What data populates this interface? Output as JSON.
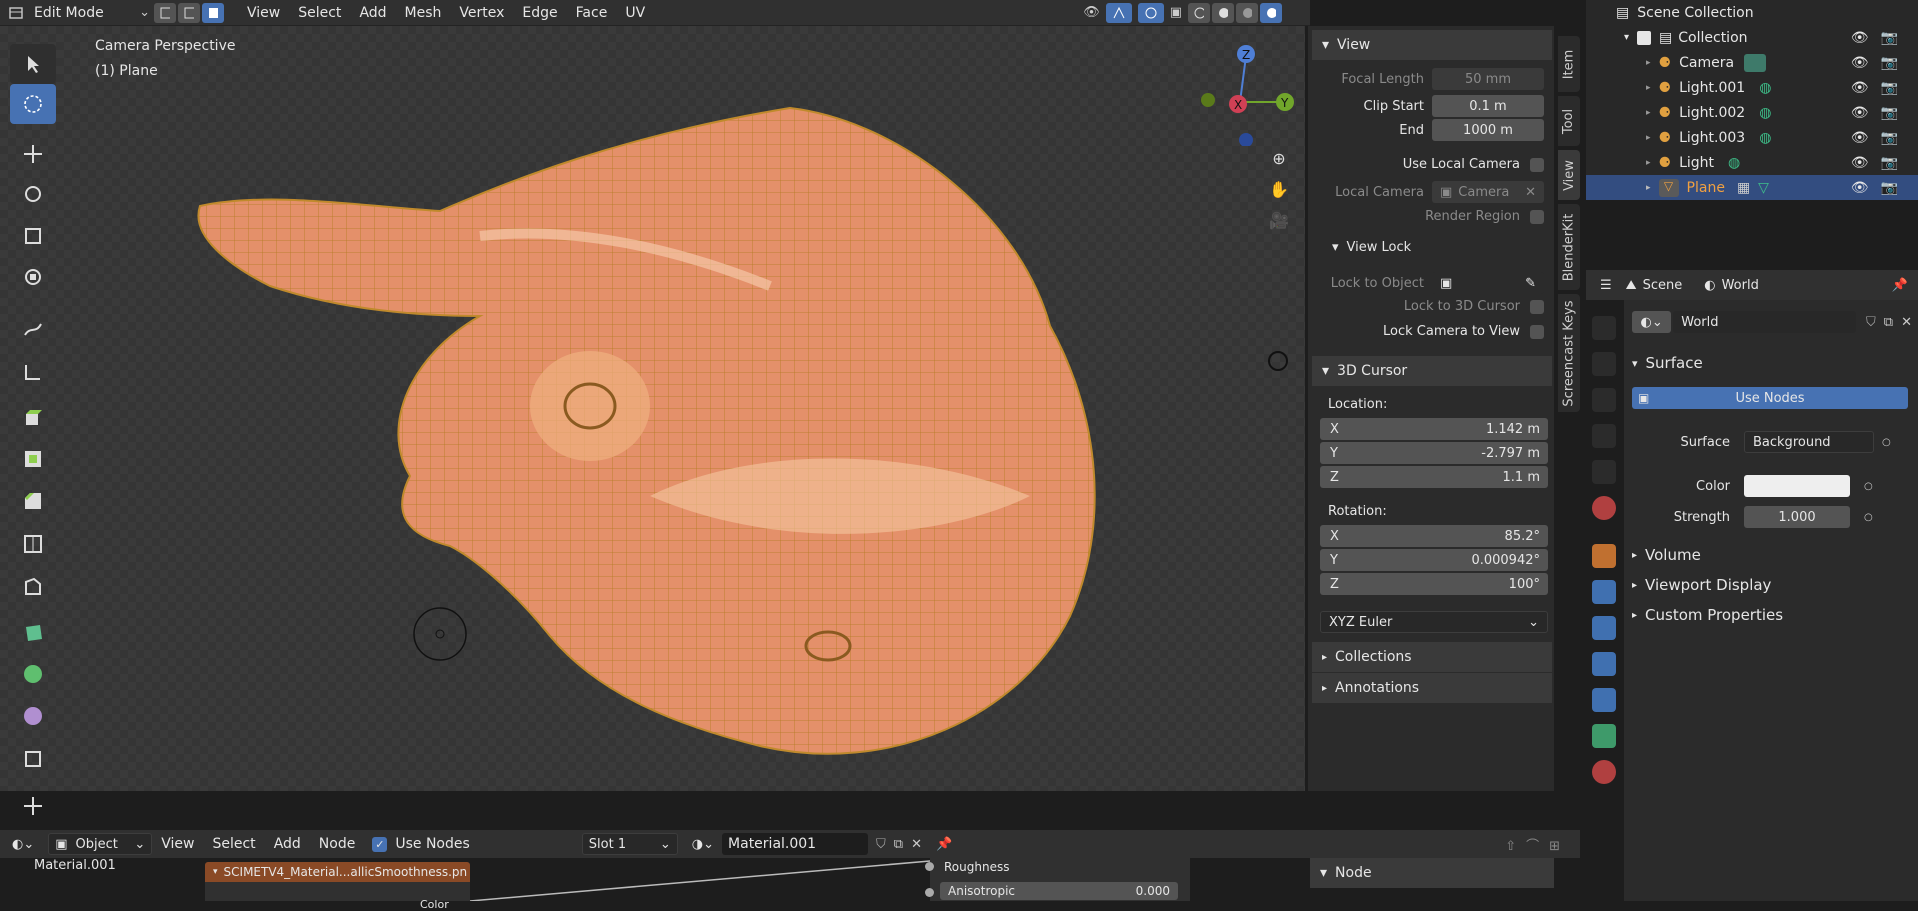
{
  "header": {
    "mode": "Edit Mode",
    "menus": [
      "View",
      "Select",
      "Add",
      "Mesh",
      "Vertex",
      "Edge",
      "Face",
      "UV"
    ]
  },
  "viewport": {
    "overlay_title": "Camera Perspective",
    "overlay_object": "(1) Plane",
    "gizmo": {
      "z": "Z",
      "y": "Y",
      "x": "X"
    }
  },
  "npanel": {
    "view_section": "View",
    "focal_length_label": "Focal Length",
    "focal_length": "50 mm",
    "clip_start_label": "Clip Start",
    "clip_start": "0.1 m",
    "end_label": "End",
    "end": "1000 m",
    "use_local_camera": "Use Local Camera",
    "local_camera_label": "Local Camera",
    "local_camera_value": "Camera",
    "render_region": "Render Region",
    "view_lock": "View Lock",
    "lock_to_object": "Lock to Object",
    "lock_to_3d_cursor": "Lock to 3D Cursor",
    "lock_camera_to_view": "Lock Camera to View",
    "cursor_section": "3D Cursor",
    "location_label": "Location:",
    "loc": {
      "x_label": "X",
      "x": "1.142 m",
      "y_label": "Y",
      "y": "-2.797 m",
      "z_label": "Z",
      "z": "1.1 m"
    },
    "rotation_label": "Rotation:",
    "rot": {
      "x_label": "X",
      "x": "85.2°",
      "y_label": "Y",
      "y": "0.000942°",
      "z_label": "Z",
      "z": "100°"
    },
    "rotation_mode": "XYZ Euler",
    "collections": "Collections",
    "annotations": "Annotations"
  },
  "vtabs": [
    "Item",
    "Tool",
    "View",
    "BlenderKit",
    "Screencast Keys"
  ],
  "outliner": {
    "title": "Scene Collection",
    "rows": [
      {
        "label": "Collection"
      },
      {
        "label": "Camera"
      },
      {
        "label": "Light.001"
      },
      {
        "label": "Light.002"
      },
      {
        "label": "Light.003"
      },
      {
        "label": "Light"
      },
      {
        "label": "Plane"
      }
    ]
  },
  "properties": {
    "scene_tab": "Scene",
    "world_tab": "World",
    "world_name": "World",
    "surface_section": "Surface",
    "use_nodes": "Use Nodes",
    "surface_label": "Surface",
    "surface_value": "Background",
    "color_label": "Color",
    "strength_label": "Strength",
    "strength": "1.000",
    "volume": "Volume",
    "viewport_display": "Viewport Display",
    "custom_properties": "Custom Properties"
  },
  "node_editor": {
    "object_mode": "Object",
    "menus": [
      "View",
      "Select",
      "Add",
      "Node"
    ],
    "use_nodes": "Use Nodes",
    "slot": "Slot 1",
    "material": "Material.001",
    "material_label": "Material.001",
    "texture_node": "SCIMETV4_Material...allicSmoothness.pn",
    "color_socket": "Color",
    "roughness": "Roughness",
    "anisotropic_label": "Anisotropic",
    "anisotropic": "0.000",
    "node_panel": "Node"
  },
  "colors": {
    "accent": "#4772b3",
    "mesh": "#e0a060",
    "mesh_wire": "#c08a2c",
    "selected_row": "#334d80"
  }
}
